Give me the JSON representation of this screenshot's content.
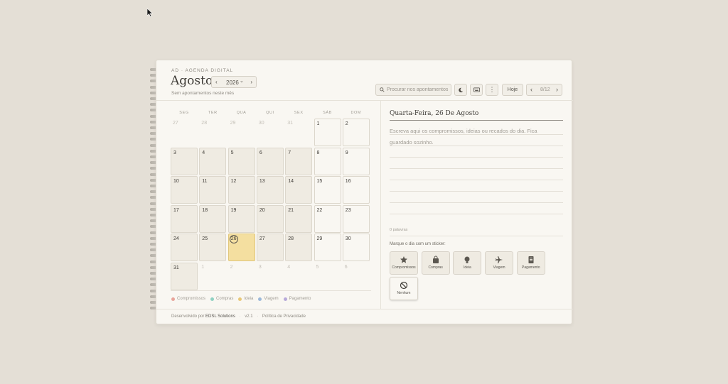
{
  "header": {
    "eyebrow": "AD · AGENDA DIGITAL",
    "month": "Agosto",
    "year": "2026",
    "subtitle": "Sem apontamentos neste mês",
    "search_placeholder": "Procurar nos apontamentos",
    "today_label": "Hoje",
    "pager": "8/12"
  },
  "calendar": {
    "weekdays": [
      "SEG",
      "TER",
      "QUA",
      "QUI",
      "SEX",
      "SÁB",
      "DOM"
    ],
    "weeks": [
      [
        "27",
        "28",
        "29",
        "30",
        "31",
        "1",
        "2"
      ],
      [
        "3",
        "4",
        "5",
        "6",
        "7",
        "8",
        "9"
      ],
      [
        "10",
        "11",
        "12",
        "13",
        "14",
        "15",
        "16"
      ],
      [
        "17",
        "18",
        "19",
        "20",
        "21",
        "22",
        "23"
      ],
      [
        "24",
        "25",
        "26",
        "27",
        "28",
        "29",
        "30"
      ],
      [
        "31",
        "1",
        "2",
        "3",
        "4",
        "5",
        "6"
      ]
    ],
    "selected": "26"
  },
  "legend": [
    {
      "label": "Compromissos",
      "color": "#e8a49a"
    },
    {
      "label": "Compras",
      "color": "#8fd1c2"
    },
    {
      "label": "Ideia",
      "color": "#e8c878"
    },
    {
      "label": "Viagem",
      "color": "#9bb8d9"
    },
    {
      "label": "Pagamento",
      "color": "#b7a9d9"
    }
  ],
  "day_panel": {
    "title": "Quarta-Feira, 26 De Agosto",
    "placeholder": "Escreva aqui os compromissos, ideias ou recados do dia. Fica guardado sozinho.",
    "word_count": "0 palavras",
    "sticker_prompt": "Marque o dia com um sticker:",
    "stickers": [
      {
        "label": "Compromissos",
        "icon": "star-icon"
      },
      {
        "label": "Compras",
        "icon": "bag-icon"
      },
      {
        "label": "Ideia",
        "icon": "lightbulb-icon"
      },
      {
        "label": "Viagem",
        "icon": "plane-icon"
      },
      {
        "label": "Pagamento",
        "icon": "receipt-icon"
      },
      {
        "label": "Nenhum",
        "icon": "ban-icon"
      }
    ]
  },
  "footer": {
    "developed_by": "Desenvolvido por",
    "company": "EDSL Solutions",
    "version": "v2.1",
    "privacy": "Política de Privacidade"
  }
}
